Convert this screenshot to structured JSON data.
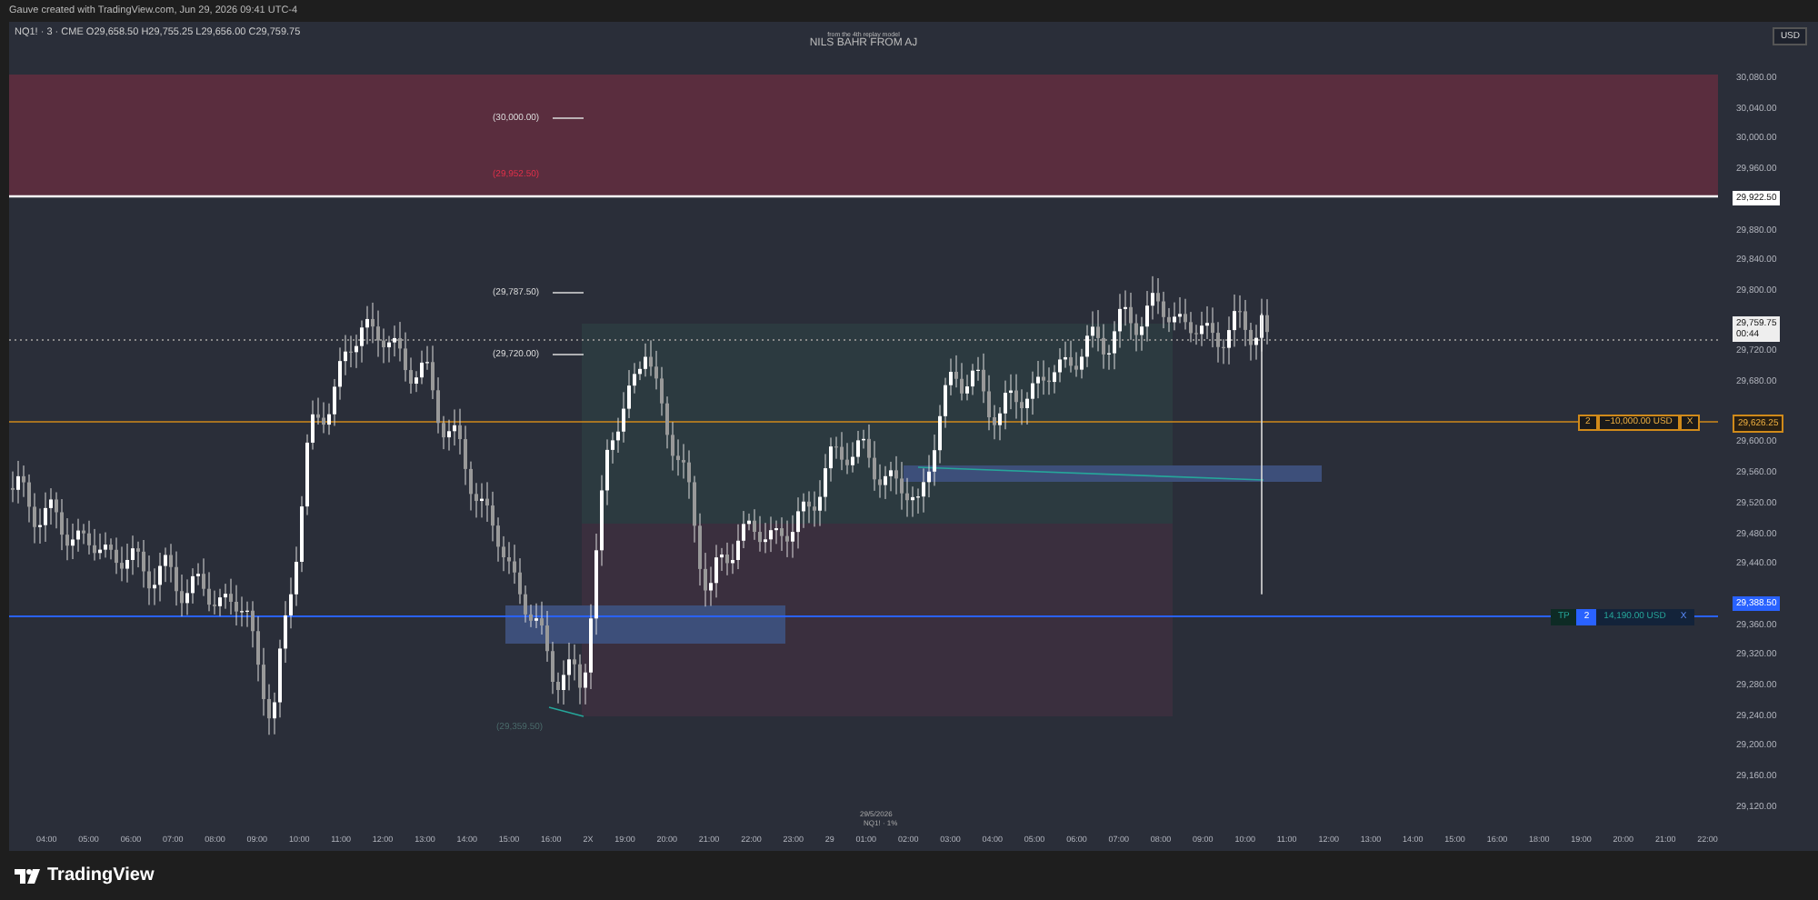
{
  "caption": "Gauve created with TradingView.com, Jun 29, 2026 09:41 UTC-4",
  "chart": {
    "legend": "NQ1! · 3 · CME  O29,658.50  H29,755.25  L29,656.00  C29,759.75",
    "watermark": [
      "from the 4th replay model",
      "NILS BAHR FROM AJ"
    ],
    "currency_button": "USD",
    "price_labels": [
      {
        "text": "(30,000.00)",
        "kind": "plain"
      },
      {
        "text": "(29,952.50)",
        "kind": "alert"
      },
      {
        "text": "(29,787.50)",
        "kind": "plain"
      },
      {
        "text": "(29,720.00)",
        "kind": "plain"
      },
      {
        "text": "(29,359.50)",
        "kind": "faint"
      }
    ],
    "orders": [
      {
        "kind": "stop",
        "quantity": "2",
        "amount": "−10,000.00 USD",
        "close": "X"
      },
      {
        "kind": "take_profit",
        "tag": "TP",
        "quantity": "2",
        "amount": "14,190.00 USD",
        "close": "X"
      }
    ],
    "price_axis": [
      {
        "label": "30,080.00",
        "kind": "tick"
      },
      {
        "label": "30,040.00",
        "kind": "tick"
      },
      {
        "label": "30,000.00",
        "kind": "tick"
      },
      {
        "label": "29,960.00",
        "kind": "tick"
      },
      {
        "label": "29,922.50",
        "kind": "white"
      },
      {
        "label": "29,880.00",
        "kind": "tick"
      },
      {
        "label": "29,840.00",
        "kind": "tick"
      },
      {
        "label": "29,800.00",
        "kind": "tick"
      },
      {
        "label": "29,759.75",
        "kind": "current",
        "countdown": "00:44"
      },
      {
        "label": "29,720.00",
        "kind": "tick"
      },
      {
        "label": "29,680.00",
        "kind": "tick"
      },
      {
        "label": "29,626.25",
        "kind": "orange"
      },
      {
        "label": "29,600.00",
        "kind": "tick"
      },
      {
        "label": "29,560.00",
        "kind": "tick"
      },
      {
        "label": "29,520.00",
        "kind": "tick"
      },
      {
        "label": "29,480.00",
        "kind": "tick"
      },
      {
        "label": "29,440.00",
        "kind": "tick"
      },
      {
        "label": "29,388.50",
        "kind": "blue"
      },
      {
        "label": "29,360.00",
        "kind": "tick"
      },
      {
        "label": "29,320.00",
        "kind": "tick"
      },
      {
        "label": "29,280.00",
        "kind": "tick"
      },
      {
        "label": "29,240.00",
        "kind": "tick"
      },
      {
        "label": "29,200.00",
        "kind": "tick"
      },
      {
        "label": "29,160.00",
        "kind": "tick"
      },
      {
        "label": "29,120.00",
        "kind": "tick"
      }
    ],
    "time_axis": [
      "04:00",
      "05:00",
      "06:00",
      "07:00",
      "08:00",
      "09:00",
      "10:00",
      "11:00",
      "12:00",
      "13:00",
      "14:00",
      "15:00",
      "16:00",
      "2X",
      "19:00",
      "20:00",
      "21:00",
      "22:00",
      "23:00",
      "29",
      "01:00",
      "02:00",
      "03:00",
      "04:00",
      "05:00",
      "06:00",
      "07:00",
      "08:00",
      "09:00",
      "10:00",
      "11:00",
      "12:00",
      "13:00",
      "14:00",
      "15:00",
      "16:00",
      "18:00",
      "19:00",
      "20:00",
      "21:00",
      "22:00"
    ],
    "date_label": [
      "29/5/2026",
      "NQ1! · 1%"
    ]
  },
  "footer": {
    "brand": "TradingView"
  }
}
